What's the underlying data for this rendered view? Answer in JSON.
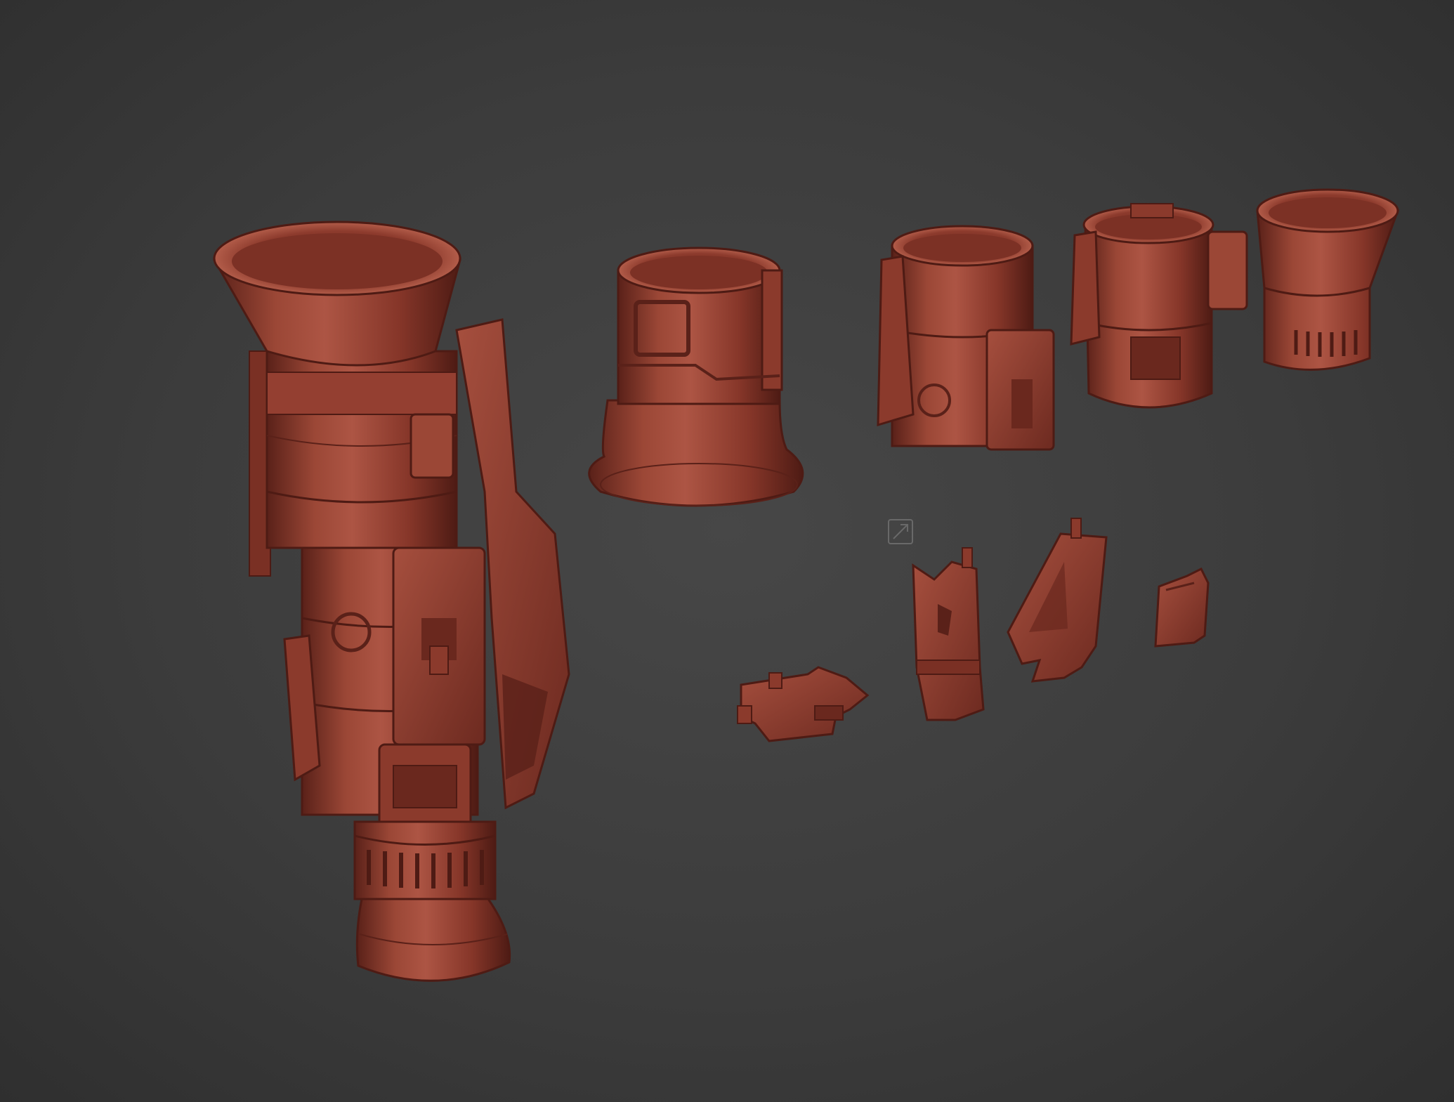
{
  "scene": {
    "background_color": "#3a3a3a",
    "material_color": "#8b3a2c",
    "material_highlight": "#b45a47",
    "material_shadow": "#4e1b14"
  },
  "viewport": {
    "center_icon": "expand-arrow-icon"
  },
  "objects": [
    {
      "id": "assembled-launcher"
    },
    {
      "id": "flared-base-section"
    },
    {
      "id": "sight-housing-section"
    },
    {
      "id": "clamp-collar-section"
    },
    {
      "id": "flared-end-cap"
    },
    {
      "id": "rear-sight-block"
    },
    {
      "id": "front-sight-post"
    },
    {
      "id": "grip-fin"
    },
    {
      "id": "small-latch"
    }
  ]
}
